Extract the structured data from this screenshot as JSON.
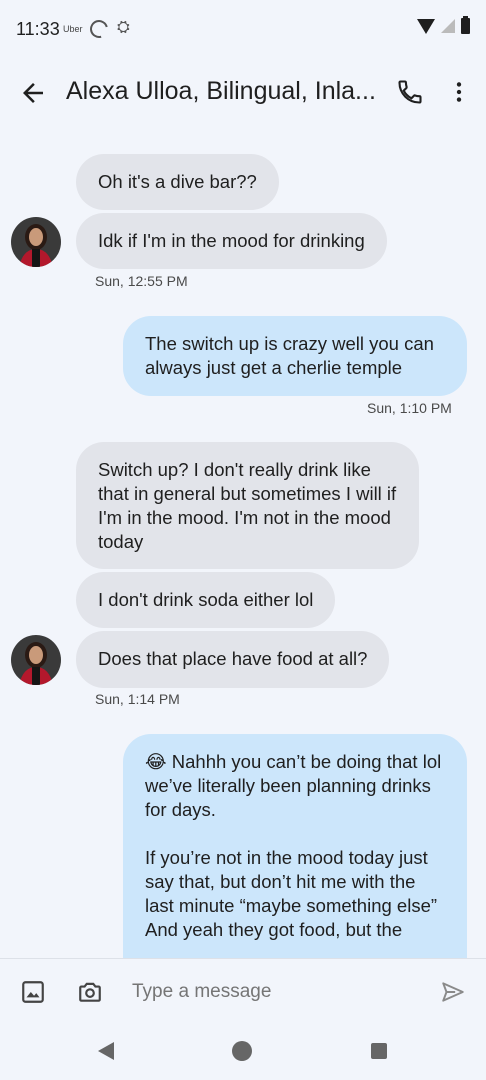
{
  "status_bar": {
    "time": "11:33",
    "app_label": "Uber",
    "icons": [
      "loading-ring-icon",
      "drive-icon",
      "wifi-icon",
      "signal-icon",
      "battery-icon"
    ]
  },
  "header": {
    "back_icon": "back-arrow-icon",
    "title": "Alexa Ulloa, Bilingual, Inla...",
    "actions": [
      "phone-icon",
      "more-vertical-icon"
    ]
  },
  "messages": [
    {
      "dir": "in",
      "text": "Oh it's a dive bar??"
    },
    {
      "dir": "in",
      "text": "Idk if I'm in the mood for drinking"
    },
    {
      "dir": "ts",
      "text": "Sun, 12:55 PM"
    },
    {
      "dir": "out",
      "text": "The switch up is crazy well you can always just get a cherlie temple"
    },
    {
      "dir": "ts",
      "text": "Sun, 1:10 PM"
    },
    {
      "dir": "in",
      "text": "Switch up? I don't really drink like that in general but sometimes I will if I'm in the mood. I'm not in the mood today"
    },
    {
      "dir": "in",
      "text": "I don't drink soda either lol"
    },
    {
      "dir": "in",
      "text": "Does that place have food at all?"
    },
    {
      "dir": "ts",
      "text": "Sun, 1:14 PM"
    },
    {
      "dir": "out",
      "lines": [
        "😂 Nahhh you can’t be doing that lol we’ve literally been planning drinks for days.",
        "If you’re not in the mood today just say that, but don’t hit me with the last minute “maybe something else”",
        "And yeah they got food, but the"
      ]
    }
  ],
  "composer": {
    "placeholder": "Type a message",
    "icons": [
      "image-icon",
      "camera-icon",
      "send-icon"
    ]
  },
  "colors": {
    "background": "#f2f5fb",
    "incoming_bubble": "#e2e4ea",
    "outgoing_bubble": "#cce6fb"
  }
}
